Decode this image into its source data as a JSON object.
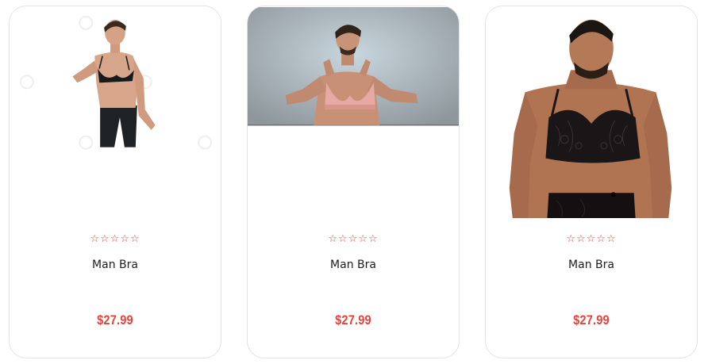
{
  "products": [
    {
      "title": "Man Bra",
      "price": "$27.99",
      "rating_symbol": "☆☆☆☆☆",
      "image": "man-in-black-bra-photo"
    },
    {
      "title": "Man Bra",
      "price": "$27.99",
      "rating_symbol": "☆☆☆☆☆",
      "image": "man-in-pink-bra-photo"
    },
    {
      "title": "Man Bra",
      "price": "$27.99",
      "rating_symbol": "☆☆☆☆☆",
      "image": "man-in-black-lace-bra-photo"
    }
  ],
  "colors": {
    "accent": "#e8413a",
    "card_border": "#e3e3e3",
    "title": "#1c1c1c"
  }
}
